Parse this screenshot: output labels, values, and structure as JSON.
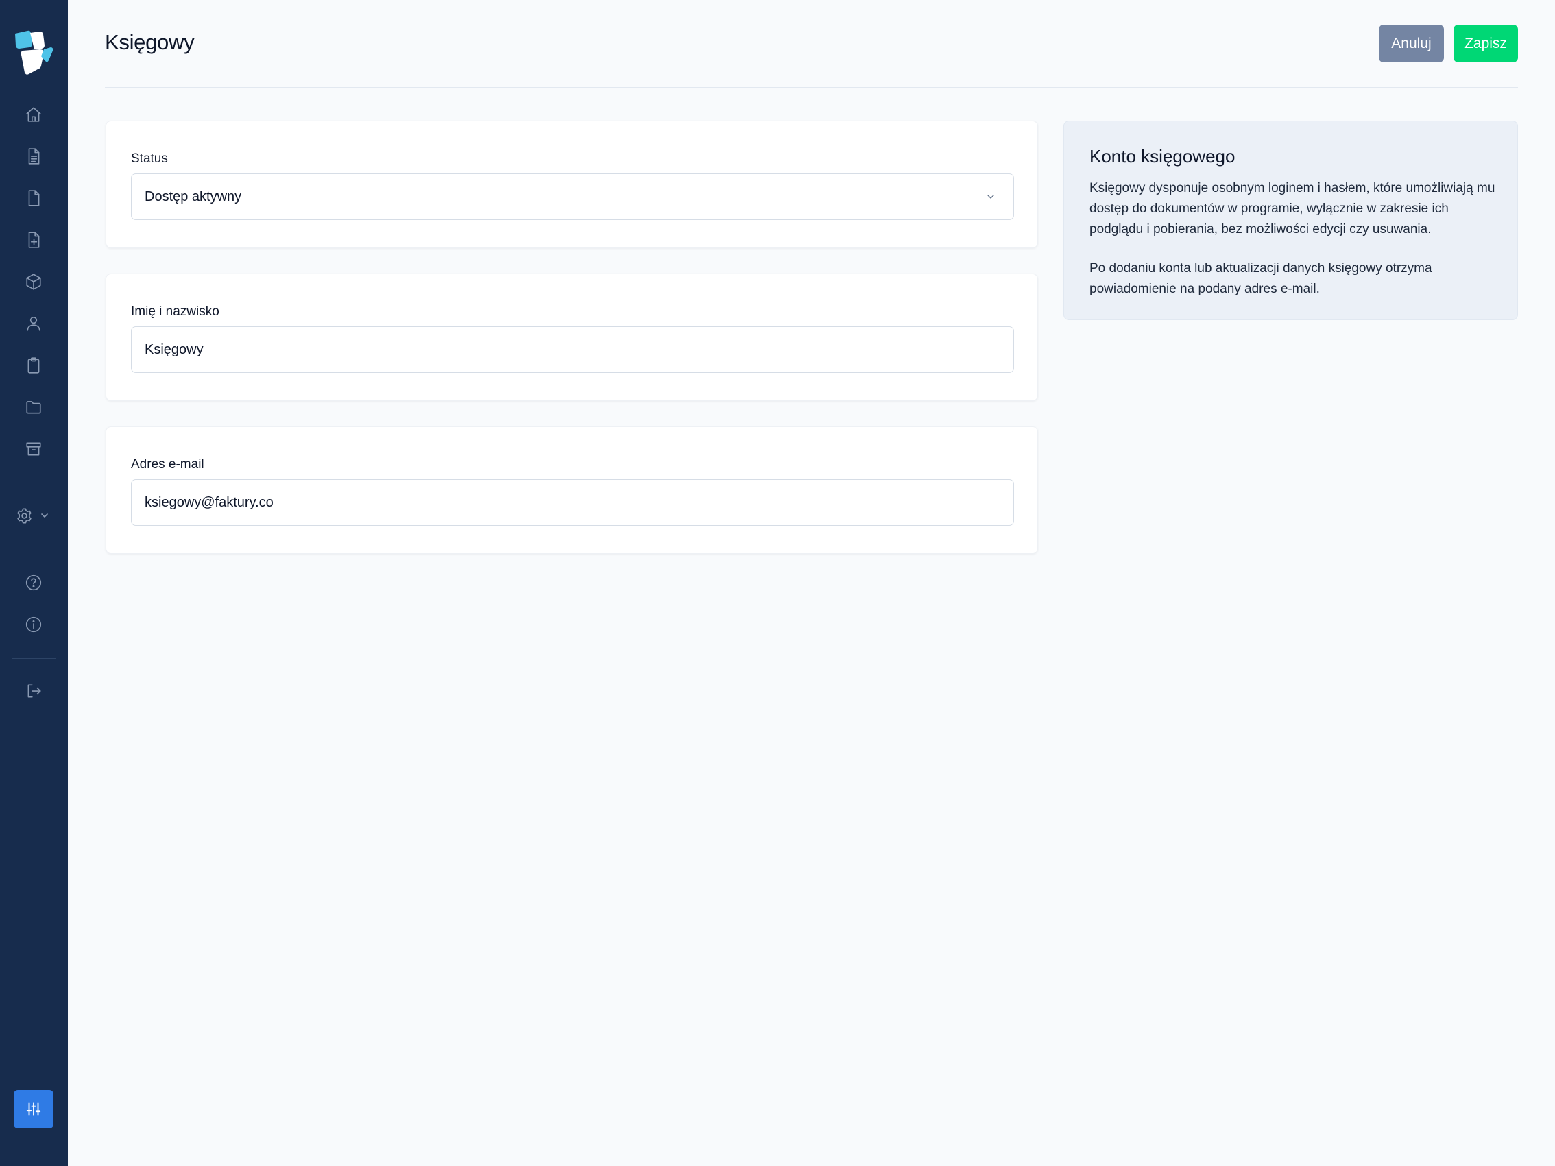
{
  "header": {
    "title": "Księgowy",
    "cancel_label": "Anuluj",
    "save_label": "Zapisz"
  },
  "sidebar": {
    "items": [
      {
        "icon": "home-icon"
      },
      {
        "icon": "document-text-icon"
      },
      {
        "icon": "document-icon"
      },
      {
        "icon": "document-add-icon"
      },
      {
        "icon": "cube-icon"
      },
      {
        "icon": "user-icon"
      },
      {
        "icon": "clipboard-icon"
      },
      {
        "icon": "folder-icon"
      },
      {
        "icon": "archive-icon"
      },
      {
        "icon": "gear-icon"
      },
      {
        "icon": "help-icon"
      },
      {
        "icon": "info-icon"
      },
      {
        "icon": "logout-icon"
      },
      {
        "icon": "adjustments-icon"
      }
    ]
  },
  "form": {
    "status": {
      "label": "Status",
      "value": "Dostęp aktywny"
    },
    "name": {
      "label": "Imię i nazwisko",
      "value": "Księgowy"
    },
    "email": {
      "label": "Adres e-mail",
      "value": "ksiegowy@faktury.co"
    }
  },
  "info": {
    "title": "Konto księgowego",
    "paragraph1": "Księgowy dysponuje osobnym loginem i hasłem, które umożliwiają mu dostęp do dokumentów w programie, wyłącznie w zakresie ich podglądu i pobierania, bez możliwości edycji czy usuwania.",
    "paragraph2": "Po dodaniu konta lub aktualizacji danych księgowy otrzyma powiadomienie na podany adres e-mail."
  },
  "colors": {
    "sidebar_bg": "#172c4d",
    "page_bg": "#f8fafc",
    "cancel_button": "#7485a3",
    "save_button": "#00d775",
    "accent_blue": "#2f7be5",
    "info_panel_bg": "#ebf0f7"
  }
}
